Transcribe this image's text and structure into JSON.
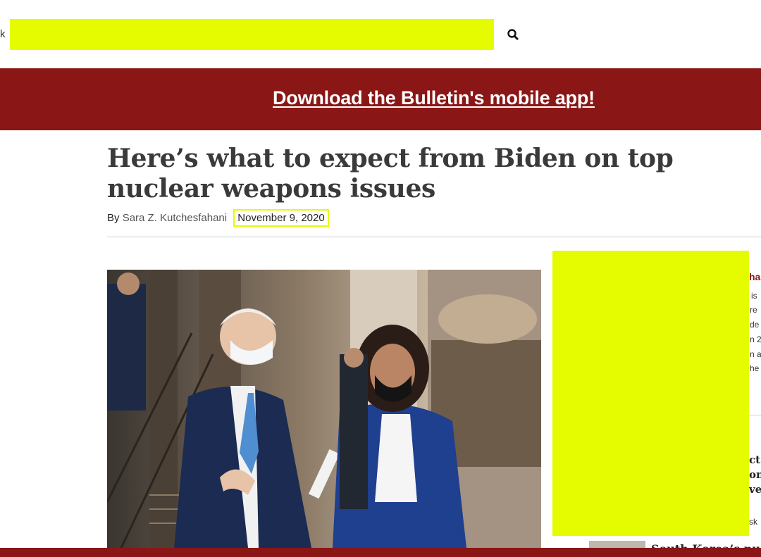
{
  "search": {
    "left_fragment": "k",
    "button_icon": "search-icon"
  },
  "banner": {
    "link_text": "Download the Bulletin's mobile app!",
    "bg_color": "#8a1616"
  },
  "article": {
    "headline": "Here’s what to expect from Biden on top nuclear weapons issues",
    "byline_prefix": "By",
    "author": "Sara Z. Kutchesfahani",
    "date": "November 9, 2020"
  },
  "sidebar": {
    "title_fragment": "ha",
    "text_fragments": [
      "is",
      "re",
      "de",
      "n 2",
      "n a",
      "he"
    ],
    "headline_fragments": [
      "ct",
      "on",
      "ve"
    ],
    "byline_fragment": "sk",
    "bottom_headline_fragment": "South Korea’s nucl"
  },
  "colors": {
    "accent": "#8a1616",
    "redaction": "#e4fb00"
  }
}
